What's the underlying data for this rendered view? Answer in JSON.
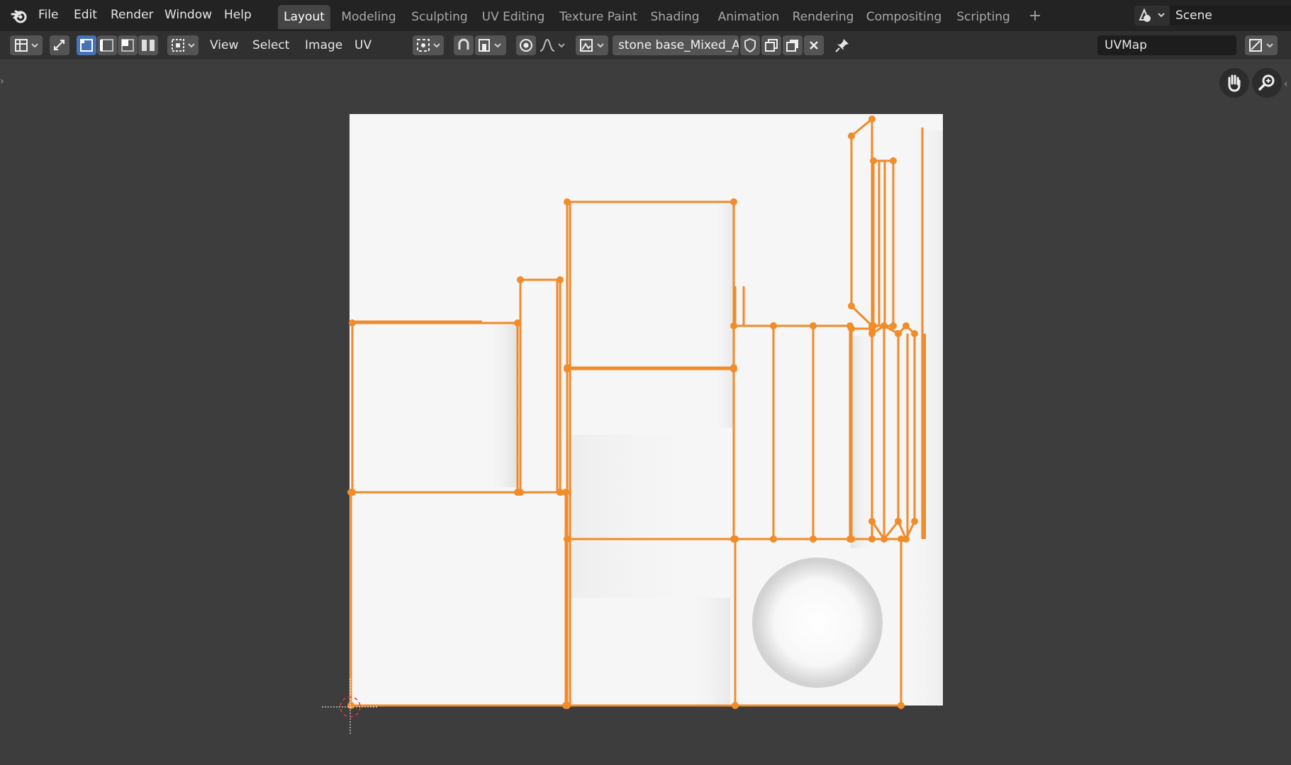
{
  "topbar": {
    "menus": [
      "File",
      "Edit",
      "Render",
      "Window",
      "Help"
    ],
    "workspaces": [
      "Layout",
      "Modeling",
      "Sculpting",
      "UV Editing",
      "Texture Paint",
      "Shading",
      "Animation",
      "Rendering",
      "Compositing",
      "Scripting"
    ],
    "active_workspace": "Layout",
    "add_label": "+",
    "scene_name": "Scene"
  },
  "header": {
    "menus": [
      "View",
      "Select",
      "Image",
      "UV"
    ],
    "image_name": "stone base_Mixed_A..",
    "uv_map": "UVMap"
  },
  "icons": {
    "blender_logo": "blender-logo-icon",
    "editor_type": "uv-editor-type-icon",
    "sync_selection": "sync-selection-icon",
    "select_modes": [
      "vertex-select-icon",
      "edge-select-icon",
      "face-select-icon",
      "island-select-icon"
    ],
    "sticky_mode": "sticky-selection-icon",
    "pivot": "pivot-point-icon",
    "snap": "snap-magnet-icon",
    "snap_target": "snap-target-icon",
    "proportional": "proportional-edit-icon",
    "falloff": "falloff-curve-icon",
    "image_browse": "image-browse-icon",
    "fake_user": "fake-user-shield-icon",
    "new_image": "new-image-icon",
    "open_image": "open-image-icon",
    "unlink": "close-icon",
    "pin": "pin-icon",
    "display_mode": "display-mode-icon",
    "hand": "hand-pan-icon",
    "zoom": "zoom-icon",
    "cursor": "2d-cursor-icon"
  },
  "colors": {
    "topbar_bg": "#232323",
    "header_bg": "#303030",
    "viewport_bg": "#3d3d3d",
    "uv_edge": "#f08a2a",
    "uv_vertex": "#f28c28",
    "select_active": "#4772b3",
    "texture_bg": "#f5f5f5"
  }
}
